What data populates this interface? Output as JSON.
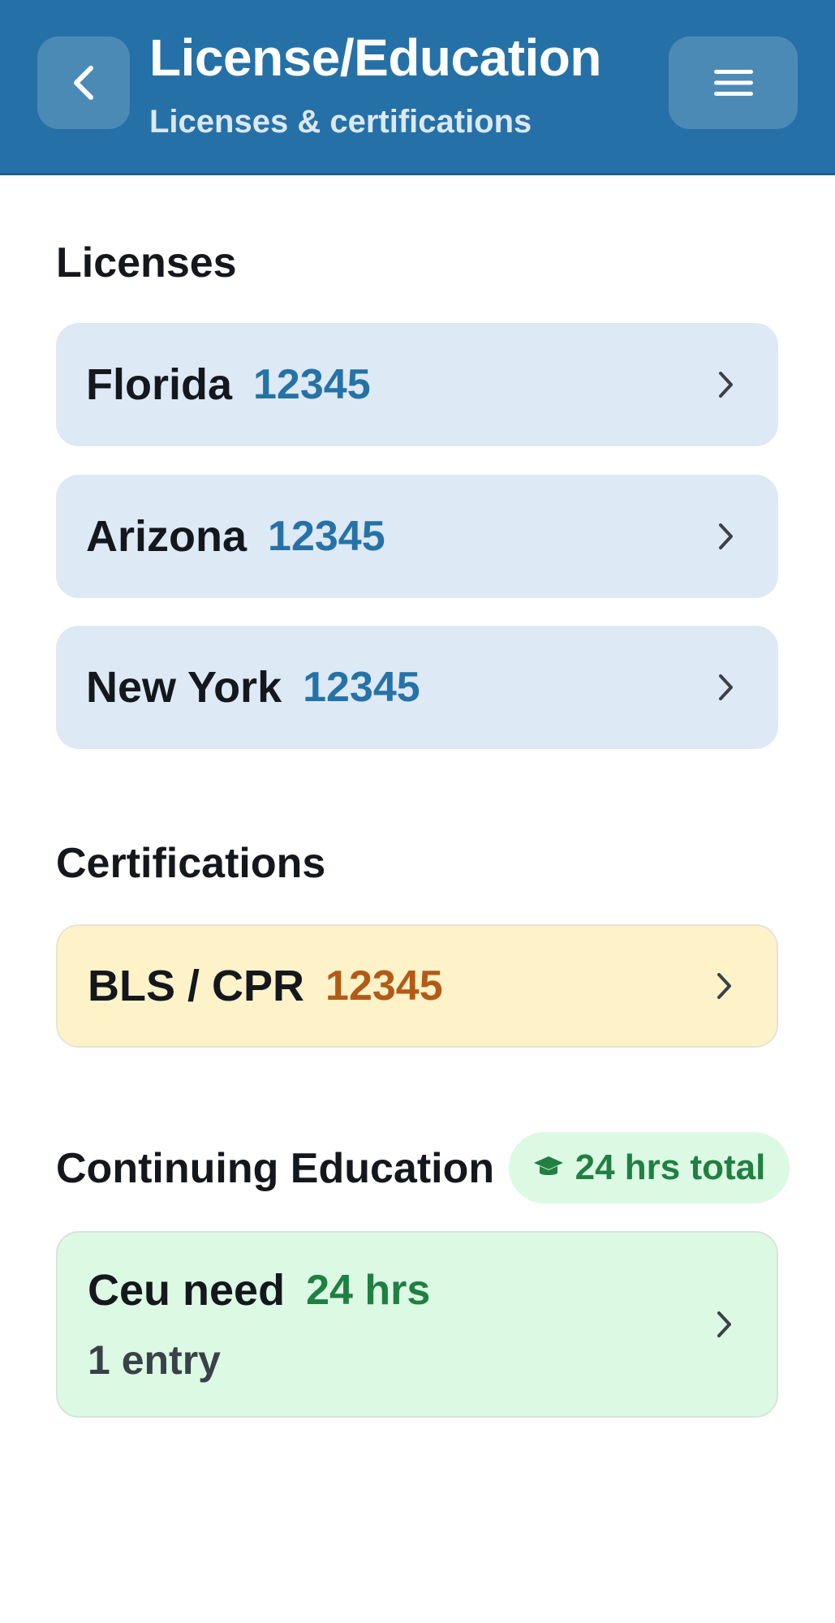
{
  "header": {
    "title": "License/Education",
    "subtitle": "Licenses & certifications",
    "back_icon": "chevron-left-icon",
    "menu_icon": "hamburger-menu-icon"
  },
  "sections": {
    "licenses": {
      "title": "Licenses",
      "items": [
        {
          "name": "Florida",
          "number": "12345"
        },
        {
          "name": "Arizona",
          "number": "12345"
        },
        {
          "name": "New York",
          "number": "12345"
        }
      ]
    },
    "certifications": {
      "title": "Certifications",
      "items": [
        {
          "name": "BLS / CPR",
          "number": "12345"
        }
      ]
    },
    "continuing_education": {
      "title": "Continuing Education",
      "badge": "24 hrs total",
      "badge_icon": "graduation-cap-icon",
      "items": [
        {
          "name": "Ceu need",
          "hours": "24 hrs",
          "entries": "1 entry"
        }
      ]
    }
  },
  "colors": {
    "header_bg": "#2571a7",
    "license_card_bg": "#dde9f5",
    "license_number": "#2572a7",
    "certification_card_bg": "#fef2c9",
    "certification_number": "#b25b17",
    "ce_card_bg": "#dcf9e4",
    "ce_accent": "#1f8041"
  }
}
